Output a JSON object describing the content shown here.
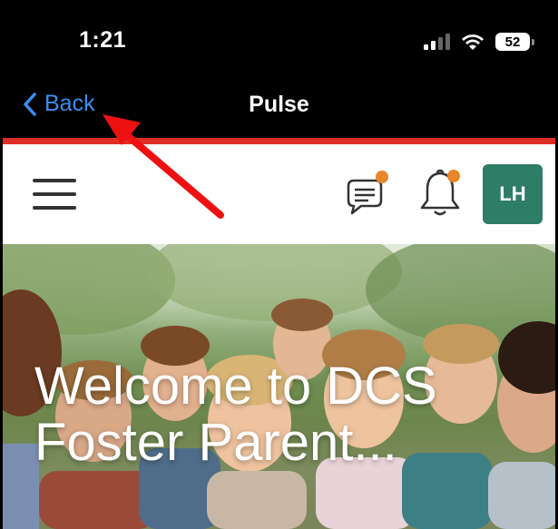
{
  "status_bar": {
    "time": "1:21",
    "battery": "52",
    "icons": [
      "signal-icon",
      "wifi-icon",
      "battery-icon"
    ]
  },
  "nav": {
    "back_label": "Back",
    "title": "Pulse",
    "back_icon": "chevron-left-icon"
  },
  "header": {
    "menu_icon": "hamburger-menu-icon",
    "chat_icon": "chat-notification-icon",
    "bell_icon": "bell-notification-icon",
    "avatar_initials": "LH"
  },
  "hero": {
    "title_line1": "Welcome to DCS",
    "title_line2": "Foster Parent..."
  },
  "colors": {
    "accent_red": "#e02e27",
    "avatar_green": "#2e7d67",
    "badge_orange": "#e8862a",
    "link_blue": "#3b8ef0",
    "annotation_arrow": "#ee1111"
  }
}
